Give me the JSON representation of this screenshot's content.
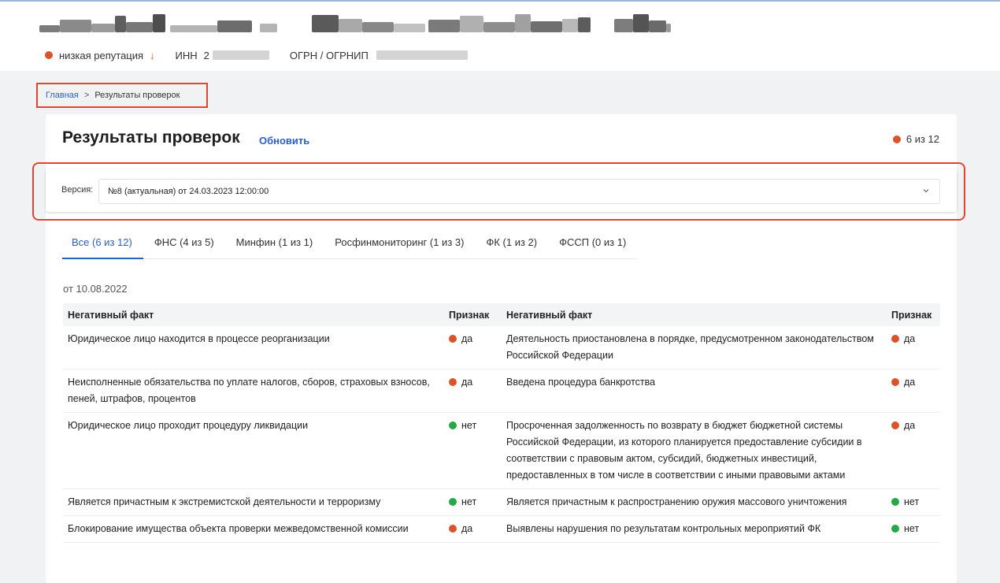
{
  "header": {
    "reputation": {
      "label": "низкая репутация",
      "arrow": "↓",
      "color": "#d9542a"
    },
    "inn_label": "ИНН",
    "inn_value_visible": "2",
    "ogrn_label": "ОГРН / ОГРНИП"
  },
  "breadcrumb": {
    "home": "Главная",
    "separator": ">",
    "current": "Результаты проверок"
  },
  "page": {
    "title": "Результаты проверок",
    "refresh": "Обновить",
    "counter": "6 из 12"
  },
  "version": {
    "label": "Версия:",
    "selected": "№8 (актуальная) от 24.03.2023 12:00:00",
    "chevron_icon": "chevron-down-icon"
  },
  "tabs": [
    {
      "label": "Все (6 из 12)",
      "active": true
    },
    {
      "label": "ФНС (4 из 5)",
      "active": false
    },
    {
      "label": "Минфин (1 из 1)",
      "active": false
    },
    {
      "label": "Росфинмониторинг (1 из 3)",
      "active": false
    },
    {
      "label": "ФК (1 из 2)",
      "active": false
    },
    {
      "label": "ФССП (0 из 1)",
      "active": false
    }
  ],
  "date_label": "от 10.08.2022",
  "table": {
    "headers": [
      "Негативный факт",
      "Признак",
      "Негативный факт",
      "Признак"
    ],
    "rows": [
      {
        "left": {
          "fact": "Юридическое лицо находится в процессе реорганизации",
          "sign": "да",
          "status": "red"
        },
        "right": {
          "fact": "Деятельность приостановлена в порядке, предусмотренном законодательством Российской Федерации",
          "sign": "да",
          "status": "red"
        }
      },
      {
        "left": {
          "fact": "Неисполненные обязательства по уплате налогов, сборов, страховых взносов, пеней, штрафов, процентов",
          "sign": "да",
          "status": "red"
        },
        "right": {
          "fact": "Введена процедура банкротства",
          "sign": "да",
          "status": "red"
        }
      },
      {
        "left": {
          "fact": "Юридическое лицо проходит процедуру ликвидации",
          "sign": "нет",
          "status": "green"
        },
        "right": {
          "fact": "Просроченная задолженность по возврату в бюджет бюджетной системы Российской Федерации, из которого планируется предоставление субсидии в соответствии с правовым актом, субсидий, бюджетных инвестиций, предоставленных в том числе в соответствии с иными правовыми актами",
          "sign": "да",
          "status": "red"
        }
      },
      {
        "left": {
          "fact": "Является причастным к экстремистской деятельности и терроризму",
          "sign": "нет",
          "status": "green"
        },
        "right": {
          "fact": "Является причастным к распространению оружия массового уничтожения",
          "sign": "нет",
          "status": "green"
        }
      },
      {
        "left": {
          "fact": "Блокирование имущества объекта проверки межведомственной комиссии",
          "sign": "да",
          "status": "red"
        },
        "right": {
          "fact": "Выявлены нарушения по результатам контрольных мероприятий ФК",
          "sign": "нет",
          "status": "green"
        }
      }
    ]
  },
  "colors": {
    "accent": "#2d5fbf",
    "danger": "#d9542a",
    "success": "#27a745",
    "highlight": "#e2452f"
  }
}
